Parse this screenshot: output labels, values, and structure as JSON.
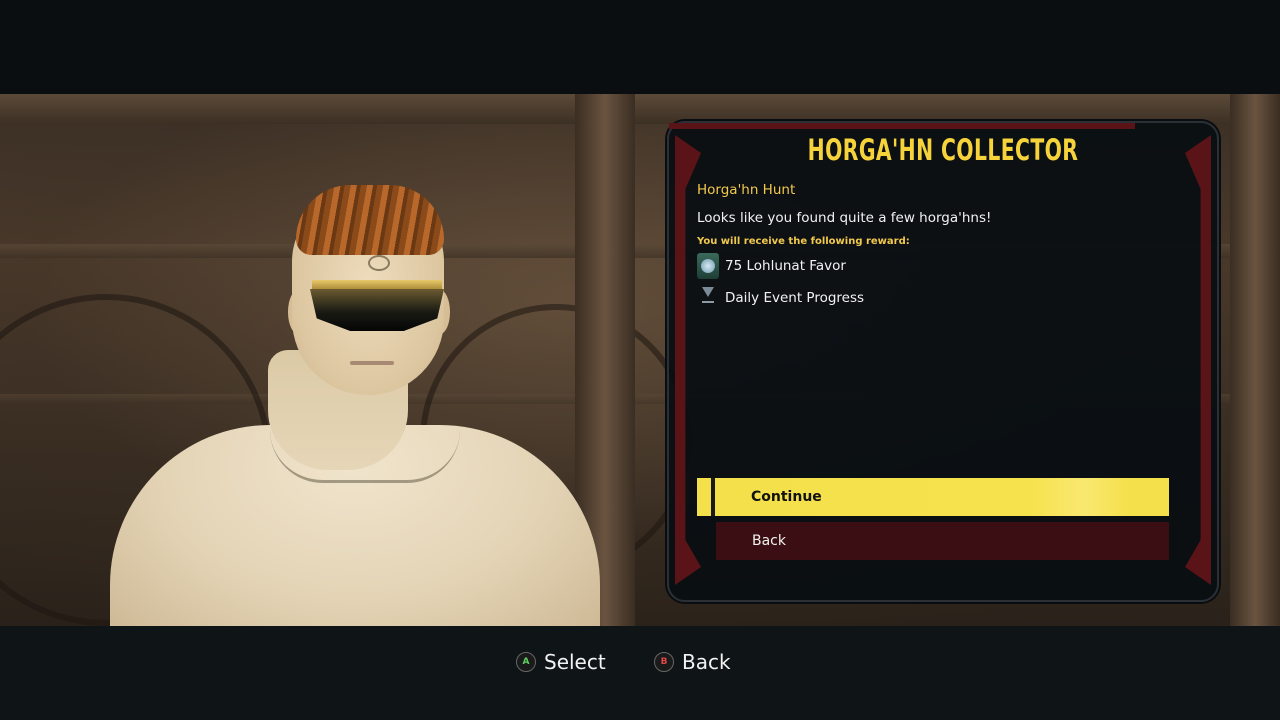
{
  "dialog": {
    "title": "HORGA'HN COLLECTOR",
    "mission_name": "Horga'hn Hunt",
    "mission_text": "Looks like you found quite a few horga'hns!",
    "reward_label": "You will receive the following reward:",
    "rewards": [
      {
        "icon": "lohlunat-favor-icon",
        "text": "75 Lohlunat Favor"
      },
      {
        "icon": "daily-event-progress-icon",
        "text": "Daily Event Progress"
      }
    ],
    "buttons": {
      "continue": "Continue",
      "back": "Back"
    }
  },
  "hints": {
    "select_glyph": "A",
    "select_label": "Select",
    "back_glyph": "B",
    "back_label": "Back"
  },
  "colors": {
    "title": "#f6d33a",
    "accent_yellow": "#f4e04a",
    "frame_red": "#5a1418",
    "back_button": "#3a0e12"
  }
}
